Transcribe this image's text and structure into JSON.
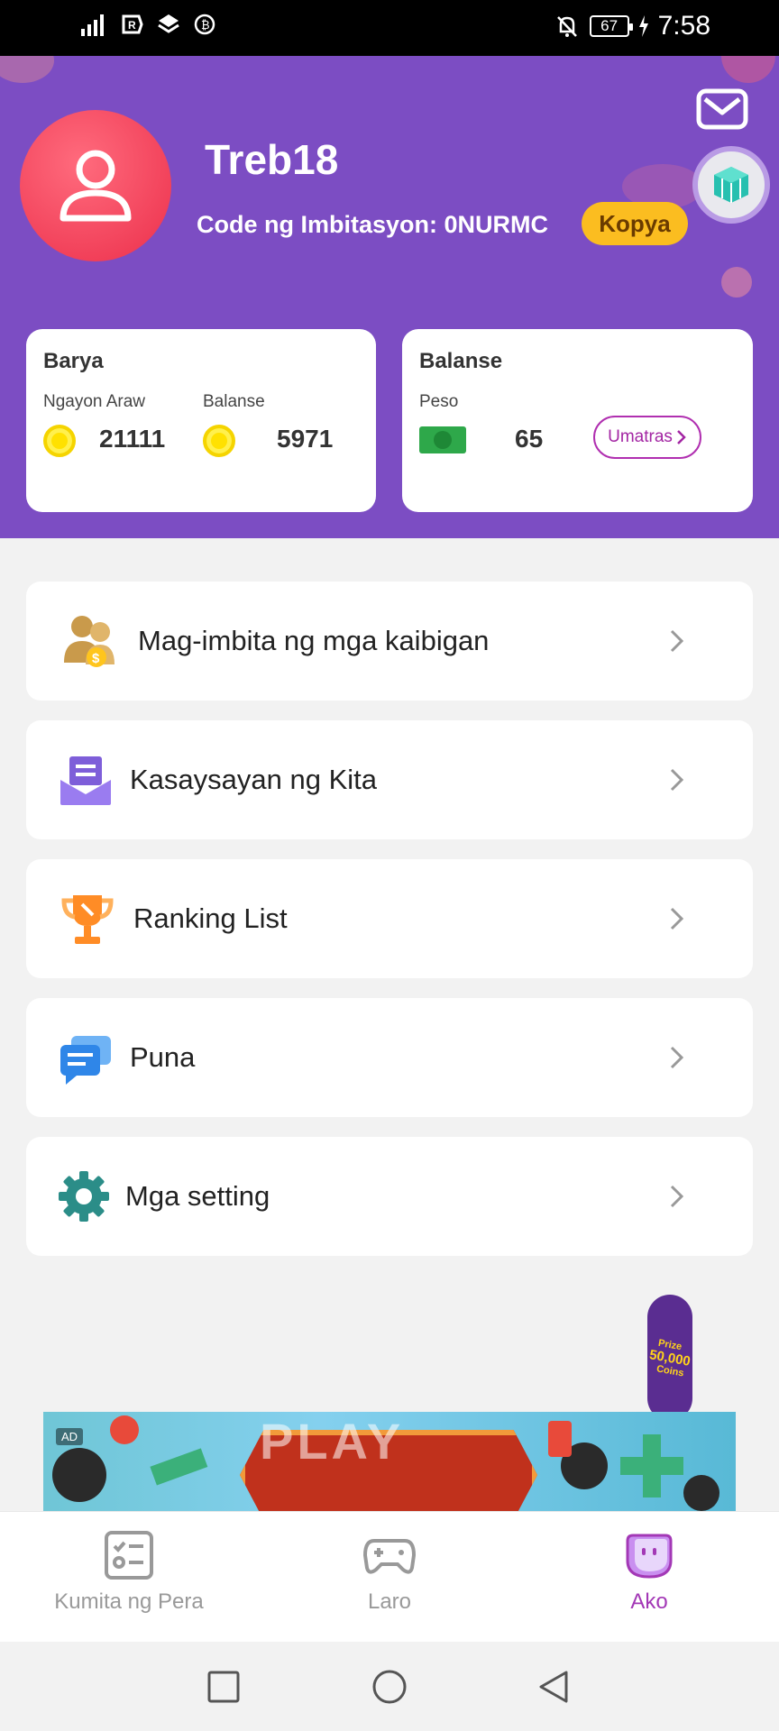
{
  "status_bar": {
    "time": "7:58",
    "battery": "67"
  },
  "profile": {
    "username": "Treb18",
    "invite_label": "Code ng Imbitasyon: 0NURMC",
    "copy_button": "Kopya"
  },
  "coins_card": {
    "title": "Barya",
    "today_label": "Ngayon Araw",
    "today_value": "21111",
    "balance_label": "Balanse",
    "balance_value": "5971"
  },
  "balance_card": {
    "title": "Balanse",
    "currency_label": "Peso",
    "value": "65",
    "withdraw_button": "Umatras"
  },
  "menu": [
    {
      "label": "Mag-imbita ng mga kaibigan",
      "icon": "invite-friends-icon"
    },
    {
      "label": "Kasaysayan ng Kita",
      "icon": "income-history-icon"
    },
    {
      "label": "Ranking List",
      "icon": "trophy-icon"
    },
    {
      "label": "Puna",
      "icon": "feedback-icon"
    },
    {
      "label": "Mga setting",
      "icon": "gear-icon"
    }
  ],
  "ad": {
    "tag": "AD",
    "text": "PLAY"
  },
  "promo": {
    "line1": "Prize",
    "line2": "50,000",
    "line3": "Coins"
  },
  "bottom_nav": [
    {
      "label": "Kumita ng Pera",
      "icon": "task-list-icon",
      "active": false
    },
    {
      "label": "Laro",
      "icon": "gamepad-icon",
      "active": false
    },
    {
      "label": "Ako",
      "icon": "profile-face-icon",
      "active": true
    }
  ],
  "colors": {
    "header_purple": "#7c4dc3",
    "accent_yellow": "#fbbd20",
    "active_nav": "#a338b6"
  }
}
